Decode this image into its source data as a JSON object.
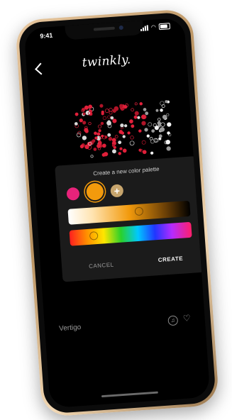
{
  "status_bar": {
    "time": "9:41"
  },
  "header": {
    "logo_text": "twinkly."
  },
  "dialog": {
    "title": "Create a new color palette",
    "add_label": "+",
    "cancel_label": "CANCEL",
    "create_label": "CREATE",
    "swatches": [
      "#e8237a",
      "#f29a0c"
    ],
    "selected_swatch": "#f29a0c"
  },
  "playlist": {
    "name": "Vertigo"
  },
  "icons": {
    "back": "chevron-left-icon",
    "music": "music-note-icon",
    "favorite": "heart-icon"
  }
}
